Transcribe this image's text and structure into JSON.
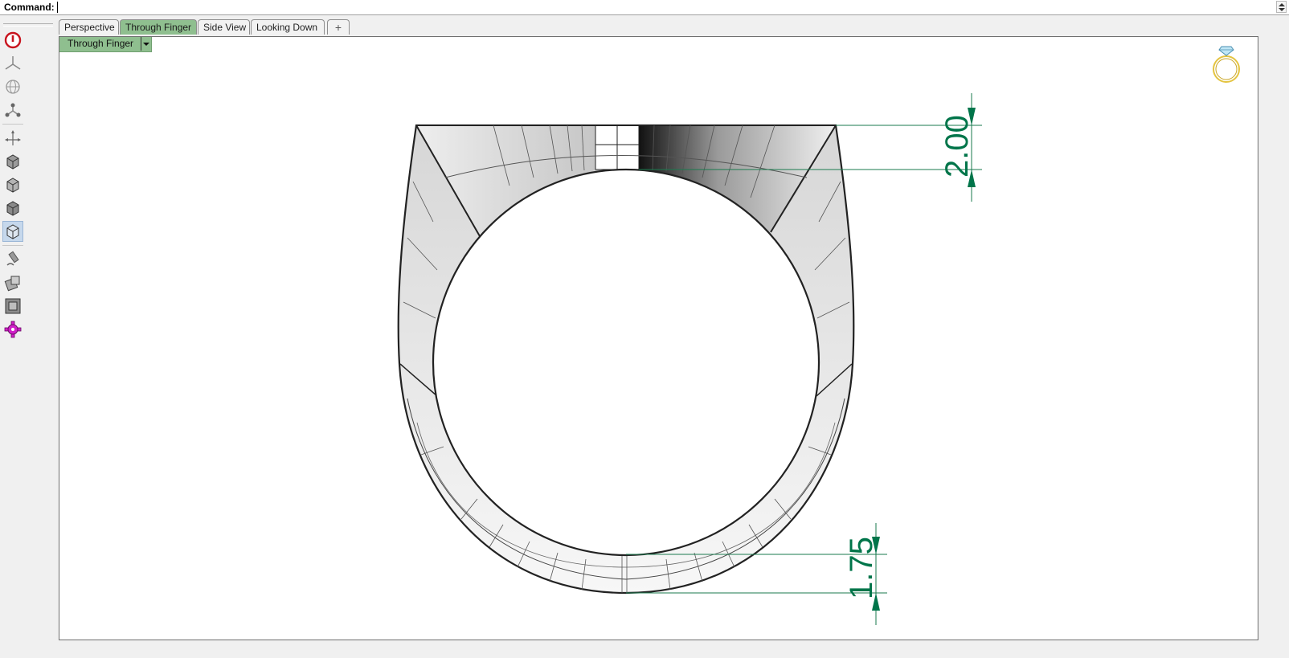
{
  "command": {
    "label": "Command:",
    "value": ""
  },
  "toolbar": {
    "buttons": [
      {
        "icon": "power-icon"
      },
      {
        "icon": "axis-tripod-icon"
      },
      {
        "icon": "globe-grid-icon"
      },
      {
        "icon": "node-tree-icon"
      },
      {
        "icon": "move-axes-icon"
      },
      {
        "icon": "cube-shaded-icon"
      },
      {
        "icon": "cube-ghosted-icon"
      },
      {
        "icon": "cube-rendered-icon"
      },
      {
        "icon": "cube-wireframe-icon",
        "active": true
      },
      {
        "icon": "pen-tool-icon"
      },
      {
        "icon": "mesh-edit-icon"
      },
      {
        "icon": "zoom-extents-icon"
      },
      {
        "icon": "gear-plugin-icon"
      }
    ]
  },
  "tabs": [
    {
      "label": "Perspective",
      "active": false
    },
    {
      "label": "Through Finger",
      "active": true
    },
    {
      "label": "Side View",
      "active": false
    },
    {
      "label": "Looking Down",
      "active": false
    },
    {
      "label": "+",
      "active": false
    }
  ],
  "viewport": {
    "title": "Through Finger",
    "dimensions": {
      "top": "2.00",
      "bottom": "1.75"
    },
    "logo_icon": "ring-diamond-icon"
  },
  "colors": {
    "active_tab": "#8fbf8f",
    "dimension": "#00754a",
    "logo": "#e4c441"
  }
}
